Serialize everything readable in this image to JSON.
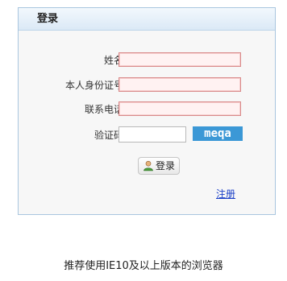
{
  "panel": {
    "title": "登录"
  },
  "form": {
    "name_label": "姓名:",
    "id_label": "本人身份证号:",
    "phone_label": "联系电话:",
    "captcha_label": "验证码:",
    "name_value": "",
    "id_value": "",
    "phone_value": "",
    "captcha_value": "",
    "captcha_text": "meqa"
  },
  "actions": {
    "login_label": "登录",
    "register_label": "注册"
  },
  "footer": {
    "text": "推荐使用IE10及以上版本的浏览器"
  },
  "icons": {
    "login_icon": "user-icon"
  },
  "colors": {
    "panel_border": "#a9c6df",
    "input_error_border": "#d98a8a",
    "input_error_bg": "#fff2f2",
    "captcha_bg": "#3b98d6",
    "link": "#1a3fc7"
  }
}
